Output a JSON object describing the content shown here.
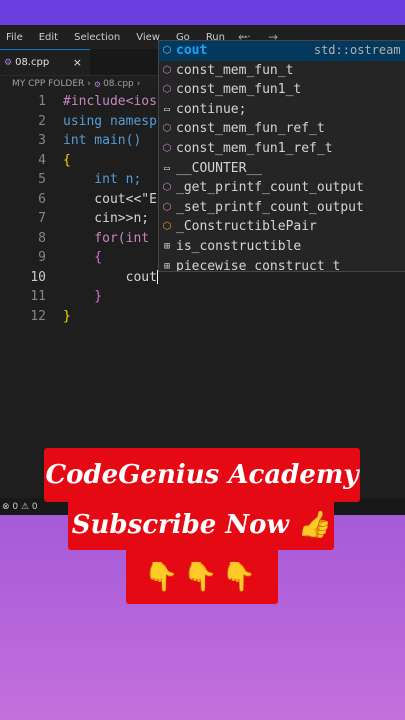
{
  "menubar": {
    "items": [
      "File",
      "Edit",
      "Selection",
      "View",
      "Go",
      "Run",
      "···"
    ],
    "back": "←",
    "forward": "→"
  },
  "tab": {
    "title": "08.cpp",
    "close": "×",
    "icon": "gear-icon"
  },
  "breadcrumb": {
    "folder": "MY CPP FOLDER",
    "sep": "›",
    "file": "08.cpp"
  },
  "line_numbers": [
    "1",
    "2",
    "3",
    "4",
    "5",
    "6",
    "7",
    "8",
    "9",
    "10",
    "11",
    "12"
  ],
  "code_lines": [
    "#include<ios",
    "using namesp",
    "int main()",
    "{",
    "    int n;",
    "    cout<<\"E",
    "    cin>>n;",
    "    for(int",
    "    {",
    "        cout",
    "    }",
    "}"
  ],
  "suggest": {
    "items": [
      {
        "label": "cout",
        "detail": "std::ostream s"
      },
      {
        "label": "const_mem_fun_t",
        "detail": ""
      },
      {
        "label": "const_mem_fun1_t",
        "detail": ""
      },
      {
        "label": "continue;",
        "detail": ""
      },
      {
        "label": "const_mem_fun_ref_t",
        "detail": ""
      },
      {
        "label": "const_mem_fun1_ref_t",
        "detail": ""
      },
      {
        "label": "__COUNTER__",
        "detail": ""
      },
      {
        "label": "_get_printf_count_output",
        "detail": ""
      },
      {
        "label": "_set_printf_count_output",
        "detail": ""
      },
      {
        "label": "_ConstructiblePair",
        "detail": ""
      },
      {
        "label": "is_constructible",
        "detail": ""
      },
      {
        "label": "piecewise_construct_t",
        "detail": ""
      }
    ]
  },
  "statusbar": {
    "problems": "⊗ 0 ⚠ 0"
  },
  "promo": {
    "line1": "CodeGenius Academy",
    "line2": "Subscribe Now 👍",
    "line3": "👇👇👇"
  },
  "colors": {
    "accent": "#0078d4",
    "banner_red": "#e50914",
    "bg_purple": "#c46fdc"
  }
}
